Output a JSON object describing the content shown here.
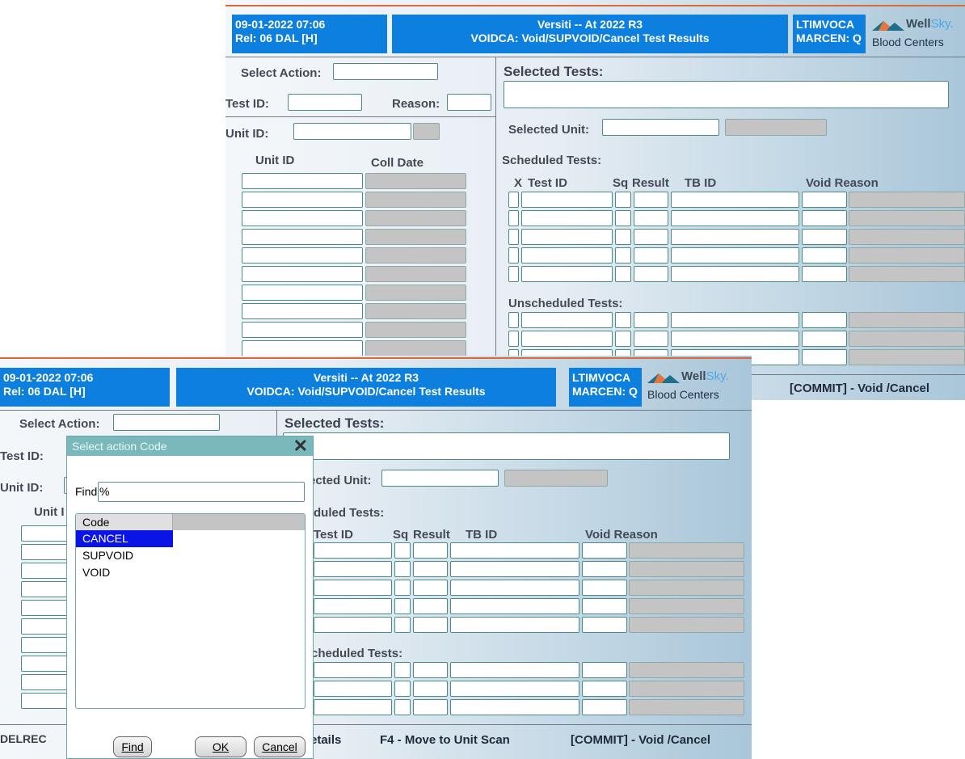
{
  "back_window": {
    "header": {
      "datetime": "09-01-2022 07:06",
      "release": "Rel: 06  DAL [H]",
      "title": "Versiti -- At 2022 R3",
      "subtitle": "VOIDCA: Void/SUPVOID/Cancel Test Results",
      "user": "LTIMVOCA",
      "center": "MARCEN: Q"
    },
    "logo": {
      "brand_a": "Well",
      "brand_b": "Sky.",
      "sub": "Blood Centers"
    },
    "labels": {
      "select_action": "Select Action:",
      "test_id": "Test ID:",
      "reason": "Reason:",
      "unit_id": "Unit ID:",
      "col_unit_id": "Unit ID",
      "col_coll_date": "Coll Date",
      "selected_tests": "Selected Tests:",
      "selected_unit": "Selected Unit:",
      "scheduled_tests": "Scheduled Tests:",
      "col_x": "X",
      "col_test_id": "Test ID",
      "col_sq": "Sq",
      "col_result": "Result",
      "col_tb_id": "TB ID",
      "col_void_reason": "Void Reason",
      "unscheduled_tests": "Unscheduled Tests:"
    },
    "status": {
      "commit": "[COMMIT] - Void /Cancel"
    }
  },
  "front_window": {
    "header": {
      "datetime": "09-01-2022 07:06",
      "release": "Rel: 06  DAL [H]",
      "title": "Versiti -- At 2022 R3",
      "subtitle": "VOIDCA: Void/SUPVOID/Cancel Test Results",
      "user": "LTIMVOCA",
      "center": "MARCEN: Q"
    },
    "logo": {
      "brand_a": "Well",
      "brand_b": "Sky.",
      "sub": "Blood Centers"
    },
    "labels": {
      "select_action": "Select Action:",
      "test_id": "Test ID:",
      "unit_id": "Unit ID:",
      "col_unit_id": "Unit I",
      "selected_tests": "Selected Tests:",
      "selected_unit": "ected Unit:",
      "scheduled_tests": "duled Tests:",
      "col_test_id": "Test ID",
      "col_sq": "Sq",
      "col_result": "Result",
      "col_tb_id": "TB ID",
      "col_void_reason": "Void Reason",
      "unscheduled_tests": "cheduled Tests:"
    },
    "status": {
      "delrec": "DELREC",
      "details": "etails",
      "f4": "F4 - Move to Unit Scan",
      "commit": "[COMMIT] - Void /Cancel"
    }
  },
  "dialog": {
    "title": "Select action Code",
    "find_label": "Find",
    "find_value": "%",
    "column": "Code",
    "items": [
      "CANCEL",
      "SUPVOID",
      "VOID"
    ],
    "selected_index": 0,
    "buttons": {
      "find": "Find",
      "ok": "OK",
      "cancel": "Cancel"
    }
  },
  "colors": {
    "header_blue": "#0d7fde",
    "accent_line": "#d96a3a",
    "selection": "#0b14e6",
    "dialog_title": "#79b8bb"
  }
}
